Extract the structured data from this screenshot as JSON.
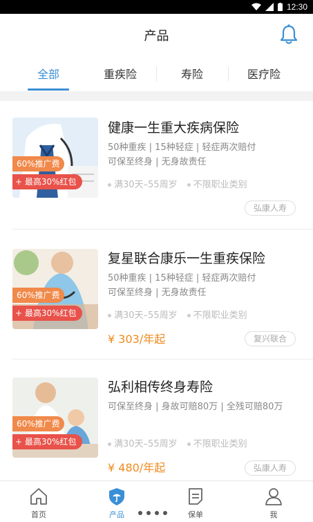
{
  "status_bar": {
    "time": "12:30"
  },
  "header": {
    "title": "产品"
  },
  "tabs": [
    {
      "label": "全部",
      "active": true
    },
    {
      "label": "重疾险",
      "active": false
    },
    {
      "label": "寿险",
      "active": false
    },
    {
      "label": "医疗险",
      "active": false
    }
  ],
  "products": [
    {
      "name": "健康一生重大疾病保险",
      "features_line1": "50种重疾 | 15种轻症 | 轻症两次赔付",
      "features_line2": "可保至终身 | 无身故责任",
      "age_range": "满30天–55周岁",
      "occupation": "不限职业类别",
      "price": "",
      "company": "弘康人寿",
      "badge_commission": "60%推广费",
      "badge_bonus": "最高30%红包"
    },
    {
      "name": "复星联合康乐一生重疾保险",
      "features_line1": "50种重疾 | 15种轻症 | 轻症两次赔付",
      "features_line2": "可保至终身 | 无身故责任",
      "age_range": "满30天–55周岁",
      "occupation": "不限职业类别",
      "price": "¥ 303/年起",
      "company": "复兴联合",
      "badge_commission": "60%推广费",
      "badge_bonus": "最高30%红包"
    },
    {
      "name": "弘利相传终身寿险",
      "features_line1": "可保至终身 | 身故可赔80万 | 全残可赔80万",
      "features_line2": "",
      "age_range": "满30天–55周岁",
      "occupation": "不限职业类别",
      "price": "¥ 480/年起",
      "company": "弘康人寿",
      "badge_commission": "60%推广费",
      "badge_bonus": "最高30%红包"
    }
  ],
  "bottom_nav": [
    {
      "label": "首页",
      "icon": "home-icon",
      "active": false
    },
    {
      "label": "产品",
      "icon": "shield-umbrella-icon",
      "active": true
    },
    {
      "label": "保单",
      "icon": "policy-document-icon",
      "active": false
    },
    {
      "label": "我",
      "icon": "user-icon",
      "active": false
    }
  ],
  "colors": {
    "accent": "#3a8fd6",
    "price": "#f08a1c",
    "badge_orange": "#f0894a",
    "badge_red": "#e8524a"
  }
}
